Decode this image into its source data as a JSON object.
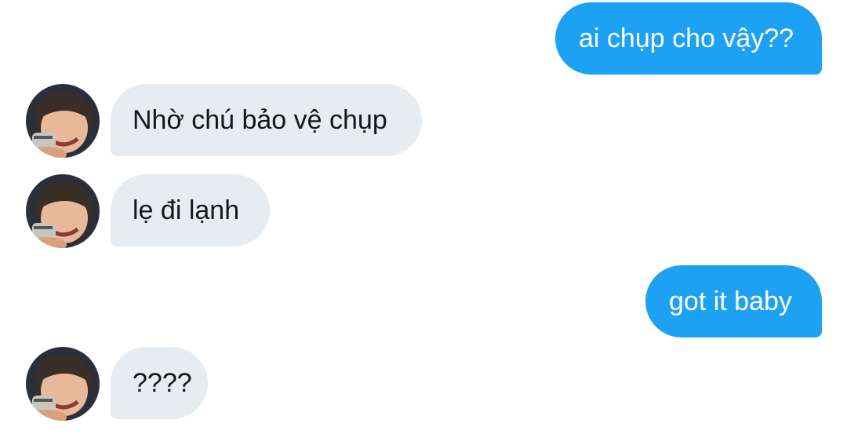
{
  "conversation": {
    "messages": [
      {
        "direction": "sent",
        "text": "ai chụp cho vậy??"
      },
      {
        "direction": "received",
        "text": "Nhờ chú bảo vệ chụp"
      },
      {
        "direction": "received",
        "text": "lẹ đi lạnh"
      },
      {
        "direction": "sent",
        "text": "got it baby"
      },
      {
        "direction": "received",
        "text": "????"
      }
    ]
  },
  "colors": {
    "sent_bubble": "#1da1f2",
    "received_bubble": "#e6ecf0",
    "sent_text": "#ffffff",
    "received_text": "#14171a",
    "background": "#ffffff"
  }
}
